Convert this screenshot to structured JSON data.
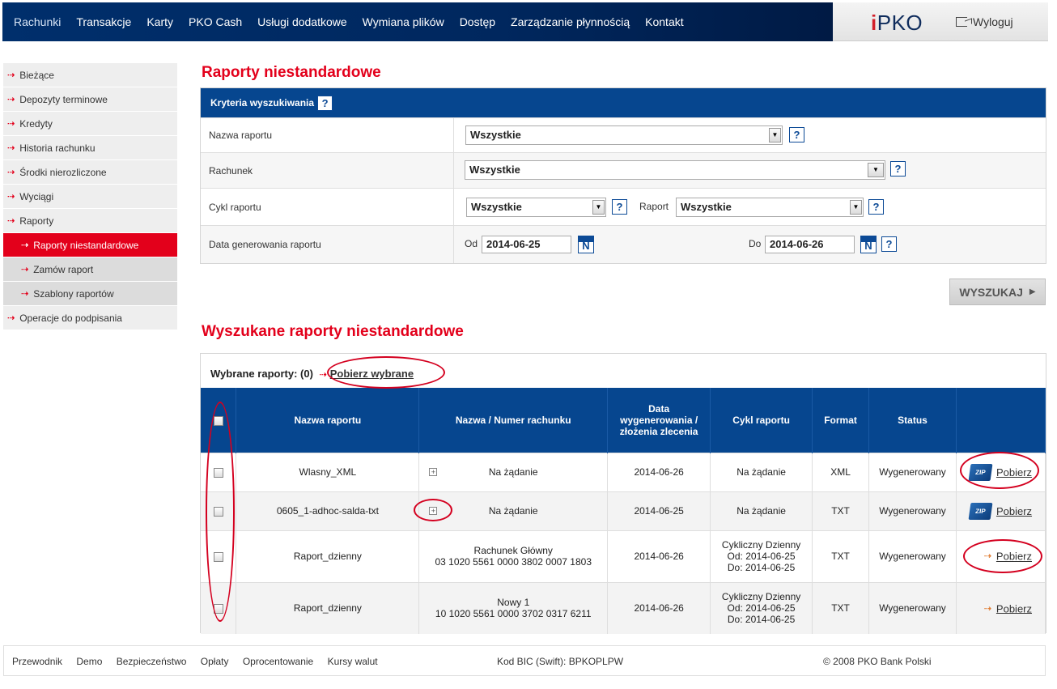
{
  "topnav": {
    "items": [
      "Rachunki",
      "Transakcje",
      "Karty",
      "PKO Cash",
      "Usługi dodatkowe",
      "Wymiana plików",
      "Dostęp",
      "Zarządzanie płynnością",
      "Kontakt"
    ],
    "active": "Rachunki"
  },
  "brand": {
    "logo_i": "i",
    "logo_rest": "PKO",
    "logout": "Wyloguj"
  },
  "sidebar": {
    "items": [
      {
        "label": "Bieżące"
      },
      {
        "label": "Depozyty terminowe"
      },
      {
        "label": "Kredyty"
      },
      {
        "label": "Historia rachunku"
      },
      {
        "label": "Środki nierozliczone"
      },
      {
        "label": "Wyciągi"
      },
      {
        "label": "Raporty"
      },
      {
        "label": "Raporty niestandardowe",
        "active": true
      },
      {
        "label": "Zamów raport"
      },
      {
        "label": "Szablony raportów"
      },
      {
        "label": "Operacje do podpisania"
      }
    ]
  },
  "page": {
    "title": "Raporty niestandardowe",
    "results_title": "Wyszukane raporty niestandardowe"
  },
  "criteria": {
    "header": "Kryteria wyszukiwania",
    "help": "?",
    "report_name_label": "Nazwa raportu",
    "report_name_value": "Wszystkie",
    "account_label": "Rachunek",
    "account_value": "Wszystkie",
    "cycle_label": "Cykl raportu",
    "cycle_value": "Wszystkie",
    "report_label": "Raport",
    "report_value": "Wszystkie",
    "date_label": "Data generowania raportu",
    "from_label": "Od",
    "from_value": "2014-06-25",
    "to_label": "Do",
    "to_value": "2014-06-26",
    "calendar_glyph": "N"
  },
  "search_button": "WYSZUKAJ",
  "results": {
    "selected_label": "Wybrane raporty: (0)",
    "download_selected": "Pobierz wybrane",
    "columns": [
      "Nazwa raportu",
      "Nazwa / Numer rachunku",
      "Data wygenerowania / złożenia zlecenia",
      "Cykl raportu",
      "Format",
      "Status"
    ],
    "rows": [
      {
        "name": "Wlasny_XML",
        "account": "Na żądanie",
        "account_no": "",
        "date": "2014-06-26",
        "cycle": "Na żądanie",
        "cycle_from": "",
        "cycle_to": "",
        "format": "XML",
        "status": "Wygenerowany",
        "action": "Pobierz",
        "zip": true,
        "expandable": true
      },
      {
        "name": "0605_1-adhoc-salda-txt",
        "account": "Na żądanie",
        "account_no": "",
        "date": "2014-06-25",
        "cycle": "Na żądanie",
        "cycle_from": "",
        "cycle_to": "",
        "format": "TXT",
        "status": "Wygenerowany",
        "action": "Pobierz",
        "zip": true,
        "expandable": true
      },
      {
        "name": "Raport_dzienny",
        "account": "Rachunek Główny",
        "account_no": "03 1020 5561 0000 3802 0007 1803",
        "date": "2014-06-26",
        "cycle": "Cykliczny Dzienny",
        "cycle_from": "Od: 2014-06-25",
        "cycle_to": "Do: 2014-06-25",
        "format": "TXT",
        "status": "Wygenerowany",
        "action": "Pobierz",
        "zip": false,
        "expandable": false
      },
      {
        "name": "Raport_dzienny",
        "account": "Nowy 1",
        "account_no": "10 1020 5561 0000 3702 0317 6211",
        "date": "2014-06-26",
        "cycle": "Cykliczny Dzienny",
        "cycle_from": "Od: 2014-06-25",
        "cycle_to": "Do: 2014-06-25",
        "format": "TXT",
        "status": "Wygenerowany",
        "action": "Pobierz",
        "zip": false,
        "expandable": false
      }
    ],
    "zip_label": "ZIP"
  },
  "footer": {
    "links": [
      "Przewodnik",
      "Demo",
      "Bezpieczeństwo",
      "Opłaty",
      "Oprocentowanie",
      "Kursy walut"
    ],
    "bic": "Kod BIC (Swift): BPKOPLPW",
    "copyright": "© 2008 PKO Bank Polski"
  },
  "colors": {
    "brand_red": "#e3001b",
    "brand_blue": "#06468f",
    "annotation": "#d4001f"
  }
}
